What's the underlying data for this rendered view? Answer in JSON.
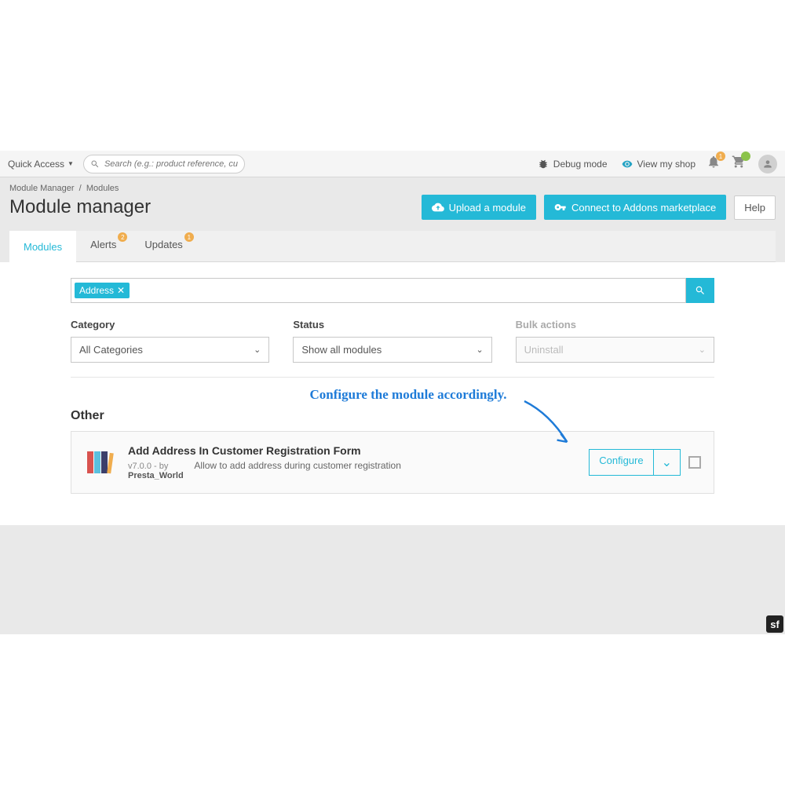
{
  "topbar": {
    "quick_access": "Quick Access",
    "search_placeholder": "Search (e.g.: product reference, custome",
    "debug": "Debug mode",
    "view_shop": "View my shop",
    "notif_count": "1"
  },
  "breadcrumb": {
    "a": "Module Manager",
    "b": "Modules"
  },
  "page_title": "Module manager",
  "buttons": {
    "upload": "Upload a module",
    "connect": "Connect to Addons marketplace",
    "help": "Help"
  },
  "tabs": {
    "modules": "Modules",
    "alerts": "Alerts",
    "alerts_badge": "2",
    "updates": "Updates",
    "updates_badge": "1"
  },
  "search": {
    "tag": "Address"
  },
  "filters": {
    "category": {
      "label": "Category",
      "value": "All Categories"
    },
    "status": {
      "label": "Status",
      "value": "Show all modules"
    },
    "bulk": {
      "label": "Bulk actions",
      "value": "Uninstall"
    }
  },
  "annotation": "Configure the module accordingly.",
  "section": "Other",
  "module": {
    "name": "Add Address In Customer Registration Form",
    "version": "v7.0.0 - by",
    "author": "Presta_World",
    "desc": "Allow to add address during customer registration",
    "action": "Configure"
  }
}
